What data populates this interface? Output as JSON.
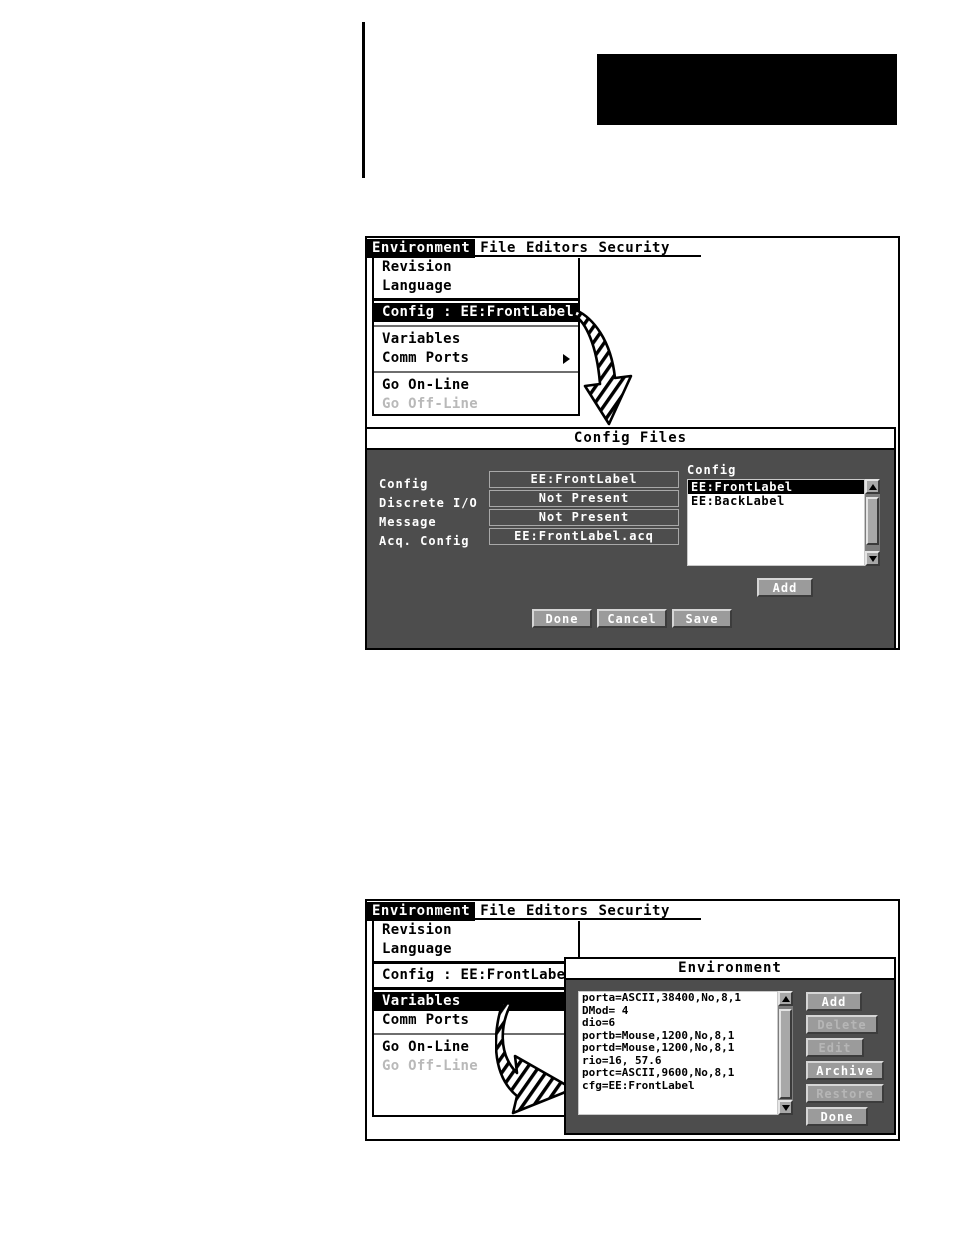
{
  "menu": {
    "bar_items": [
      "Environment",
      "File",
      "Editors",
      "Security"
    ],
    "selected_bar_item": "Environment",
    "items": {
      "revision": "Revision",
      "language": "Language",
      "config": "Config : EE:FrontLabel",
      "variables": "Variables",
      "comm_ports": "Comm Ports",
      "go_online": "Go On-Line",
      "go_offline": "Go Off-Line"
    }
  },
  "config_files_dialog": {
    "title": "Config Files",
    "fields": [
      {
        "label": "Config",
        "value": "EE:FrontLabel"
      },
      {
        "label": "Discrete I/O",
        "value": "Not Present"
      },
      {
        "label": "Message",
        "value": "Not Present"
      },
      {
        "label": "Acq. Config",
        "value": "EE:FrontLabel.acq"
      }
    ],
    "list_label": "Config",
    "list_items": [
      {
        "text": "EE:FrontLabel",
        "selected": true
      },
      {
        "text": "EE:BackLabel",
        "selected": false
      }
    ],
    "add_label": "Add",
    "buttons": [
      {
        "label": "Done",
        "enabled": true
      },
      {
        "label": "Cancel",
        "enabled": true
      },
      {
        "label": "Save",
        "enabled": true
      }
    ]
  },
  "environment_dialog": {
    "title": "Environment",
    "variables": [
      "porta=ASCII,38400,No,8,1",
      "DMod= 4",
      "dio=6",
      "portb=Mouse,1200,No,8,1",
      "portd=Mouse,1200,No,8,1",
      "rio=16, 57.6",
      "portc=ASCII,9600,No,8,1",
      "cfg=EE:FrontLabel"
    ],
    "buttons": [
      {
        "label": "Add",
        "enabled": true
      },
      {
        "label": "Delete",
        "enabled": false
      },
      {
        "label": "Edit",
        "enabled": false
      },
      {
        "label": "Archive",
        "enabled": true
      },
      {
        "label": "Restore",
        "enabled": false
      },
      {
        "label": "Done",
        "enabled": true
      }
    ]
  },
  "colors": {
    "dialog_bg": "#4d4d4d",
    "button_face": "#9b9b9b",
    "selection": "#000000",
    "panel_bg": "#ffffff"
  }
}
